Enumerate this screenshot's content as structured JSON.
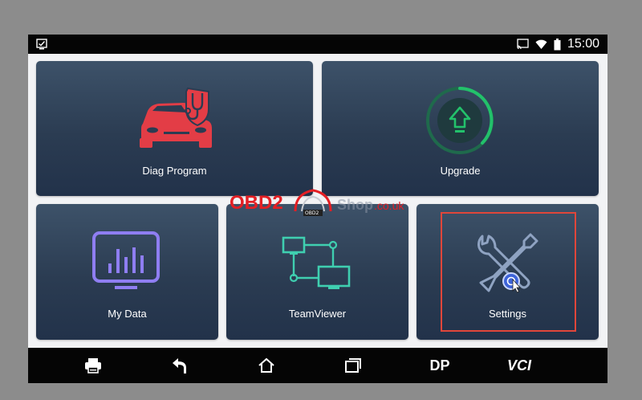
{
  "statusbar": {
    "time": "15:00",
    "icons": [
      "screenshot-icon",
      "cast-icon",
      "wifi-icon",
      "battery-icon"
    ]
  },
  "tiles": [
    {
      "id": "diag",
      "label": "Diag Program",
      "icon": "car-diagnostic-icon"
    },
    {
      "id": "upgrade",
      "label": "Upgrade",
      "icon": "upgrade-arrow-icon"
    },
    {
      "id": "mydata",
      "label": "My Data",
      "icon": "bar-chart-monitor-icon"
    },
    {
      "id": "teamviewer",
      "label": "TeamViewer",
      "icon": "network-monitors-icon"
    },
    {
      "id": "settings",
      "label": "Settings",
      "icon": "wrench-screwdriver-icon",
      "selected": true
    }
  ],
  "navbar": {
    "items": [
      {
        "id": "print",
        "icon": "printer-icon"
      },
      {
        "id": "back",
        "icon": "back-arrow-icon"
      },
      {
        "id": "home",
        "icon": "home-icon"
      },
      {
        "id": "recent",
        "icon": "recent-apps-icon"
      },
      {
        "id": "dp",
        "label": "DP"
      },
      {
        "id": "vci",
        "label": "VCI"
      }
    ]
  },
  "watermark": {
    "brand": "OBD2",
    "badge": "OBD2",
    "shop": "Shop",
    "domain": ".co.uk"
  },
  "colors": {
    "accent_red": "#e41f24",
    "tile_blue": "#2b3c52",
    "upgrade_green": "#23c16b",
    "mydata_purple": "#8f7ef2",
    "teamviewer_teal": "#3fcfb0",
    "settings_steel": "#8fa3c2",
    "selection_border": "#e0463a"
  }
}
